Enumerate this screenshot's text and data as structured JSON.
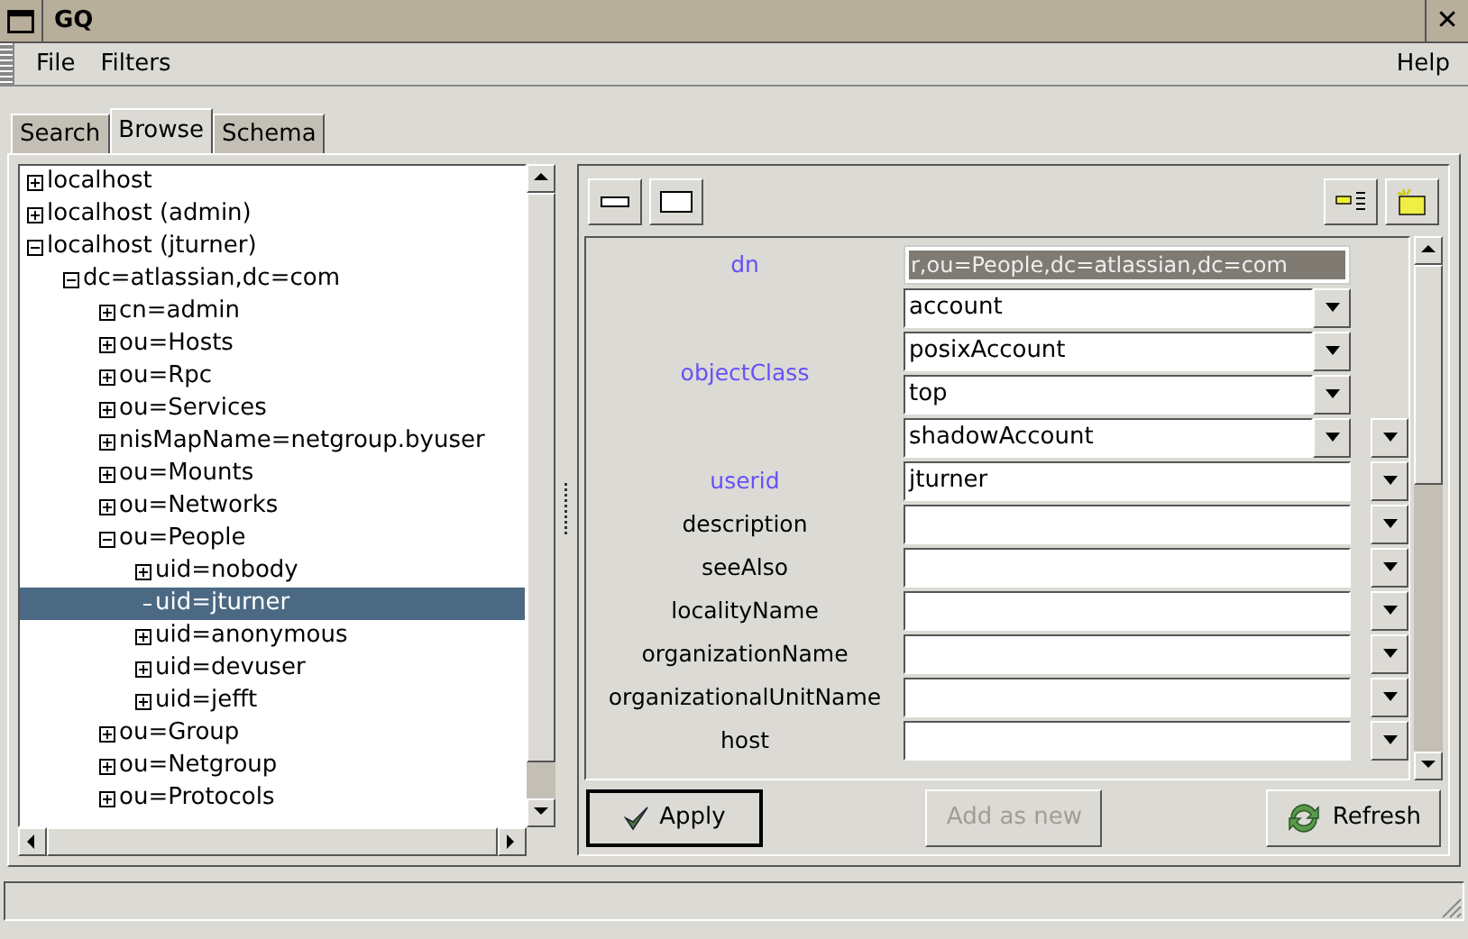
{
  "window": {
    "title": "GQ",
    "close": "✕"
  },
  "menu": [
    "File",
    "Filters"
  ],
  "help": "Help",
  "tabs": [
    {
      "label": "Search",
      "selected": false
    },
    {
      "label": "Browse",
      "selected": true
    },
    {
      "label": "Schema",
      "selected": false
    }
  ],
  "tree": [
    {
      "label": "localhost",
      "expanded": false,
      "kind": "branch",
      "selected": false
    },
    {
      "label": "localhost (admin)",
      "expanded": false,
      "kind": "branch",
      "selected": false
    },
    {
      "label": "localhost (jturner)",
      "expanded": true,
      "kind": "branch",
      "selected": false,
      "children": [
        {
          "label": "dc=atlassian,dc=com",
          "expanded": true,
          "kind": "branch",
          "selected": false,
          "children": [
            {
              "label": "cn=admin",
              "expanded": false,
              "kind": "branch",
              "selected": false
            },
            {
              "label": "ou=Hosts",
              "expanded": false,
              "kind": "branch",
              "selected": false
            },
            {
              "label": "ou=Rpc",
              "expanded": false,
              "kind": "branch",
              "selected": false
            },
            {
              "label": "ou=Services",
              "expanded": false,
              "kind": "branch",
              "selected": false
            },
            {
              "label": "nisMapName=netgroup.byuser",
              "expanded": false,
              "kind": "branch",
              "selected": false
            },
            {
              "label": "ou=Mounts",
              "expanded": false,
              "kind": "branch",
              "selected": false
            },
            {
              "label": "ou=Networks",
              "expanded": false,
              "kind": "branch",
              "selected": false
            },
            {
              "label": "ou=People",
              "expanded": true,
              "kind": "branch",
              "selected": false,
              "children": [
                {
                  "label": "uid=nobody",
                  "expanded": false,
                  "kind": "branch",
                  "selected": false
                },
                {
                  "label": "uid=jturner",
                  "kind": "leaf",
                  "selected": true
                },
                {
                  "label": "uid=anonymous",
                  "expanded": false,
                  "kind": "branch",
                  "selected": false
                },
                {
                  "label": "uid=devuser",
                  "expanded": false,
                  "kind": "branch",
                  "selected": false
                },
                {
                  "label": "uid=jefft",
                  "expanded": false,
                  "kind": "branch",
                  "selected": false
                }
              ]
            },
            {
              "label": "ou=Group",
              "expanded": false,
              "kind": "branch",
              "selected": false
            },
            {
              "label": "ou=Netgroup",
              "expanded": false,
              "kind": "branch",
              "selected": false
            },
            {
              "label": "ou=Protocols",
              "expanded": false,
              "kind": "branch",
              "selected": false
            }
          ]
        }
      ]
    }
  ],
  "attributes": [
    {
      "name": "dn",
      "required": true,
      "kind": "dn",
      "values": [
        "r,ou=People,dc=atlassian,dc=com"
      ]
    },
    {
      "name": "objectClass",
      "required": true,
      "kind": "combo",
      "values": [
        "account",
        "posixAccount",
        "top",
        "shadowAccount"
      ]
    },
    {
      "name": "userid",
      "required": true,
      "kind": "text",
      "values": [
        "jturner"
      ]
    },
    {
      "name": "description",
      "required": false,
      "kind": "text"
    },
    {
      "name": "seeAlso",
      "required": false,
      "kind": "text"
    },
    {
      "name": "localityName",
      "required": false,
      "kind": "text"
    },
    {
      "name": "organizationName",
      "required": false,
      "kind": "text"
    },
    {
      "name": "organizationalUnitName",
      "required": false,
      "kind": "text"
    },
    {
      "name": "host",
      "required": false,
      "kind": "text"
    }
  ],
  "buttons": [
    {
      "label": "Apply",
      "disabled": false,
      "kind": "apply"
    },
    {
      "label": "Add as new",
      "disabled": true,
      "kind": "add"
    },
    {
      "label": "Refresh",
      "disabled": false,
      "kind": "refresh"
    }
  ]
}
